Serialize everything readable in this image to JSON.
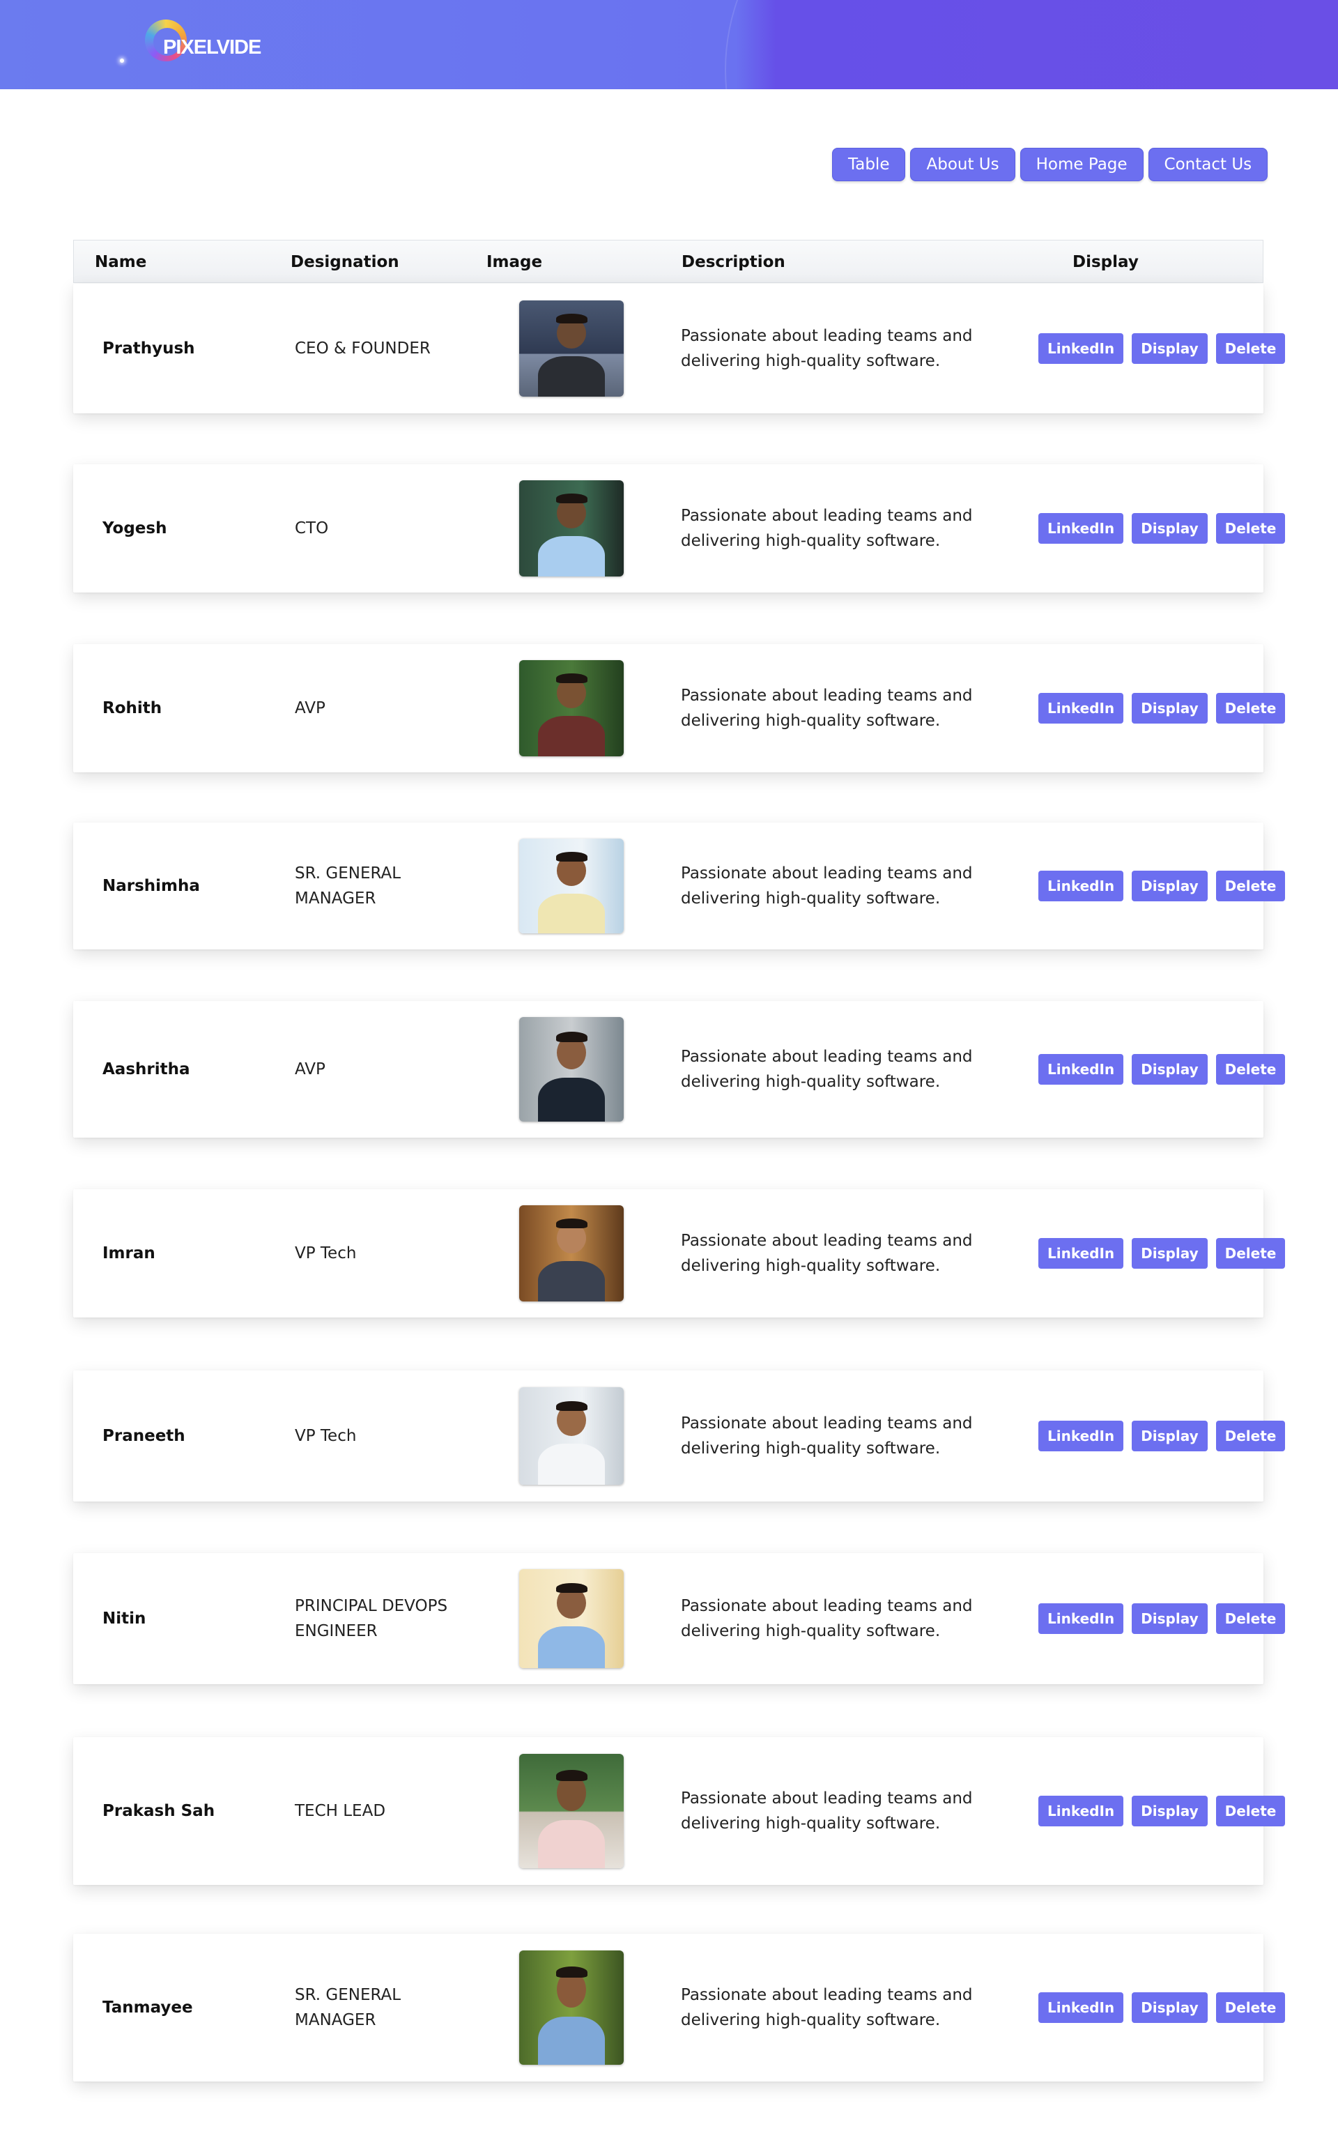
{
  "brand": {
    "logo_text": "PIXELVIDE"
  },
  "nav": [
    "Table",
    "About Us",
    "Home Page",
    "Contact Us"
  ],
  "table": {
    "headers": {
      "name": "Name",
      "designation": "Designation",
      "image": "Image",
      "description": "Description",
      "display": "Display"
    },
    "actions": {
      "linkedin": "LinkedIn",
      "display": "Display",
      "delete": "Delete"
    },
    "rows": [
      {
        "name": "Prathyush",
        "designation": "CEO & FOUNDER",
        "description": "Passionate about leading teams and delivering high-quality software."
      },
      {
        "name": "Yogesh",
        "designation": "CTO",
        "description": "Passionate about leading teams and delivering high-quality software."
      },
      {
        "name": "Rohith",
        "designation": "AVP",
        "description": "Passionate about leading teams and delivering high-quality software."
      },
      {
        "name": "Narshimha",
        "designation": "SR. GENERAL MANAGER",
        "description": "Passionate about leading teams and delivering high-quality software."
      },
      {
        "name": "Aashritha",
        "designation": "AVP",
        "description": "Passionate about leading teams and delivering high-quality software."
      },
      {
        "name": "Imran",
        "designation": "VP Tech",
        "description": "Passionate about leading teams and delivering high-quality software."
      },
      {
        "name": "Praneeth",
        "designation": "VP Tech",
        "description": "Passionate about leading teams and delivering high-quality software."
      },
      {
        "name": "Nitin",
        "designation": "PRINCIPAL DEVOPS ENGINEER",
        "description": "Passionate about leading teams and delivering high-quality software."
      },
      {
        "name": "Prakash Sah",
        "designation": "TECH LEAD",
        "description": "Passionate about leading teams and delivering high-quality software."
      },
      {
        "name": "Tanmayee",
        "designation": "SR. GENERAL MANAGER",
        "description": "Passionate about leading teams and delivering high-quality software."
      }
    ]
  },
  "colors": {
    "accent": "#6c6ff0",
    "header_start": "#6b7bef",
    "header_end": "#6a4fe6"
  }
}
